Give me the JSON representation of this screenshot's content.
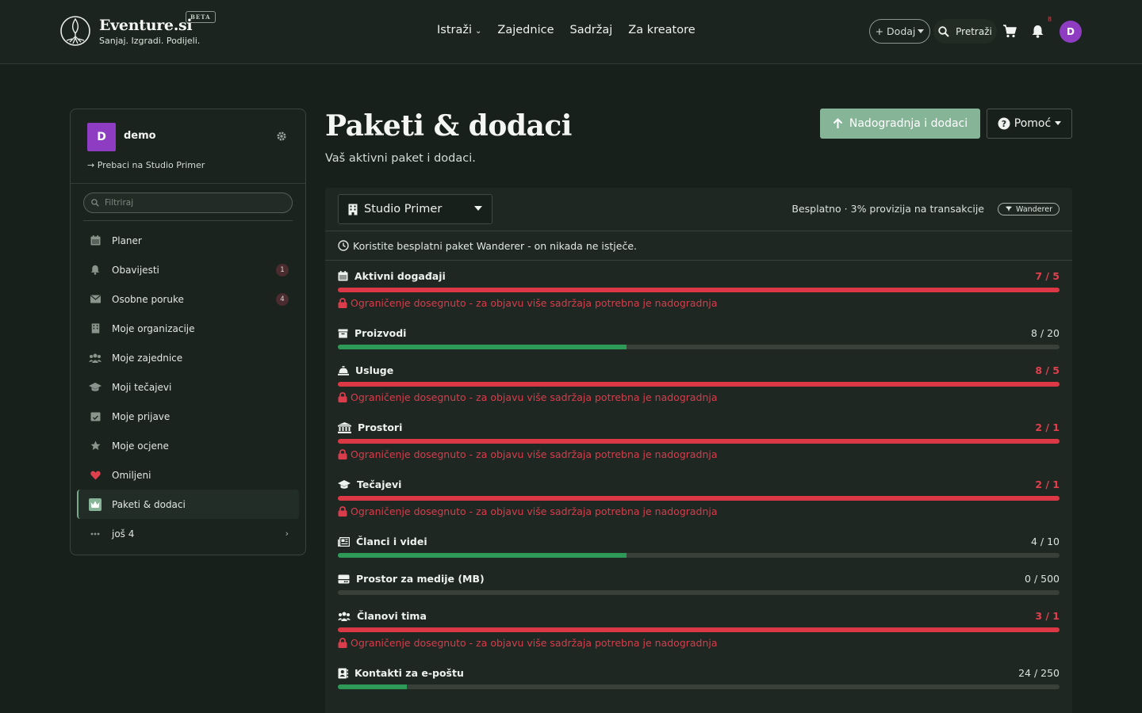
{
  "brand": {
    "name": "Eventure.si",
    "tagline": "Sanjaj. Izgradi. Podijeli.",
    "beta": "BETA"
  },
  "nav": {
    "items": [
      {
        "label": "Istraži",
        "has_dropdown": true
      },
      {
        "label": "Zajednice"
      },
      {
        "label": "Sadržaj"
      },
      {
        "label": "Za kreatore"
      }
    ],
    "add_label": "+ Dodaj",
    "search_label": "Pretraži",
    "notif_count": "8",
    "avatar_letter": "D"
  },
  "sidebar": {
    "user": {
      "initial": "D",
      "name": "demo",
      "switch_label": "Prebaci na Studio Primer"
    },
    "filter_placeholder": "Filtriraj",
    "items": [
      {
        "label": "Planer",
        "icon": "calendar-icon"
      },
      {
        "label": "Obavijesti",
        "icon": "bell-icon",
        "badge": "1"
      },
      {
        "label": "Osobne poruke",
        "icon": "envelope-icon",
        "badge": "4"
      },
      {
        "label": "Moje organizacije",
        "icon": "building-icon"
      },
      {
        "label": "Moje zajednice",
        "icon": "users-icon"
      },
      {
        "label": "Moji tečajevi",
        "icon": "graduation-cap-icon"
      },
      {
        "label": "Moje prijave",
        "icon": "calendar-check-icon"
      },
      {
        "label": "Moje ocjene",
        "icon": "star-icon"
      },
      {
        "label": "Omiljeni",
        "icon": "heart-icon"
      },
      {
        "label": "Paketi & dodaci",
        "icon": "crown-icon",
        "active": true
      },
      {
        "label": "još 4",
        "icon": "ellipsis-icon",
        "more": true
      }
    ]
  },
  "page": {
    "title": "Paketi & dodaci",
    "subtitle": "Vaš aktivni paket i dodaci.",
    "upgrade_label": "Nadogradnja i dodaci",
    "help_label": "Pomoć"
  },
  "panel": {
    "org_name": "Studio Primer",
    "plan_info": "Besplatno · 3% provizija na transakcije",
    "plan_badge": "Wanderer",
    "note": "Koristite besplatni paket Wanderer - on nikada ne istječe.",
    "limit_warning": "Ograničenje dosegnuto - za objavu više sadržaja potrebna je nadogradnja",
    "metrics": [
      {
        "label": "Aktivni događaji",
        "icon": "calendar-icon",
        "used": 7,
        "limit": 5,
        "display": "7 / 5",
        "over": true
      },
      {
        "label": "Proizvodi",
        "icon": "box-icon",
        "used": 8,
        "limit": 20,
        "display": "8 / 20",
        "over": false
      },
      {
        "label": "Usluge",
        "icon": "bell-concierge-icon",
        "used": 8,
        "limit": 5,
        "display": "8 / 5",
        "over": true
      },
      {
        "label": "Prostori",
        "icon": "landmark-icon",
        "used": 2,
        "limit": 1,
        "display": "2 / 1",
        "over": true
      },
      {
        "label": "Tečajevi",
        "icon": "graduation-cap-icon",
        "used": 2,
        "limit": 1,
        "display": "2 / 1",
        "over": true
      },
      {
        "label": "Članci i videi",
        "icon": "newspaper-icon",
        "used": 4,
        "limit": 10,
        "display": "4 / 10",
        "over": false
      },
      {
        "label": "Prostor za medije (MB)",
        "icon": "hard-drive-icon",
        "used": 0,
        "limit": 500,
        "display": "0 / 500",
        "over": false
      },
      {
        "label": "Članovi tima",
        "icon": "users-icon",
        "used": 3,
        "limit": 1,
        "display": "3 / 1",
        "over": true
      },
      {
        "label": "Kontakti za e-poštu",
        "icon": "address-book-icon",
        "used": 24,
        "limit": 250,
        "display": "24 / 250",
        "over": false
      }
    ]
  },
  "colors": {
    "accent": "#86b497",
    "danger": "#dc3745",
    "ok": "#2d9a58",
    "avatar": "#8e3dc2"
  }
}
